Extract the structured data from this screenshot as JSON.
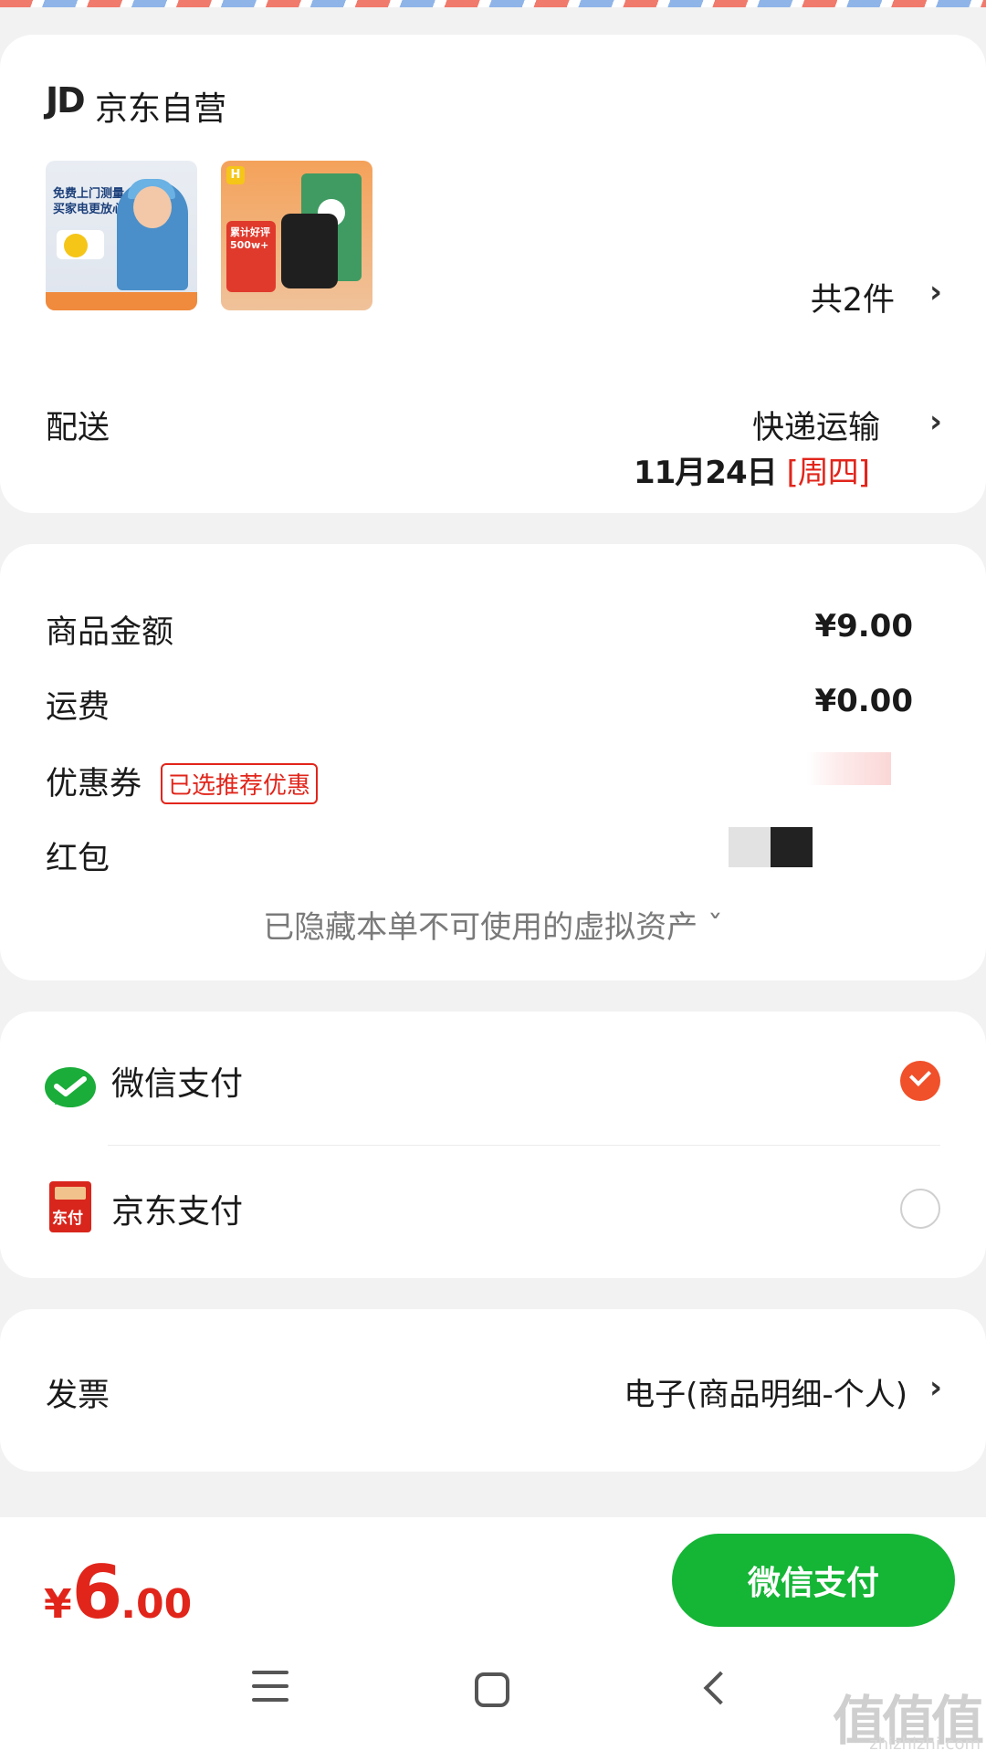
{
  "store": {
    "logo": "JD",
    "name": "京东自营"
  },
  "products": {
    "item1_caption_lines": [
      "免费上门测量",
      "买家电更放心"
    ],
    "item2_tag_lines": [
      "累计好评",
      "500w+"
    ],
    "count_text": "共2件"
  },
  "shipping": {
    "label": "配送",
    "method": "快递运输",
    "date": "11月24日",
    "weekday": "[周四]"
  },
  "amounts": {
    "goods_label": "商品金额",
    "goods_value": "¥9.00",
    "freight_label": "运费",
    "freight_value": "¥0.00",
    "coupon_label": "优惠券",
    "coupon_tag": "已选推荐优惠",
    "redpacket_label": "红包",
    "hidden_assets": "已隐藏本单不可使用的虚拟资产 ˇ"
  },
  "payment": {
    "options": [
      {
        "label": "微信支付",
        "selected": true
      },
      {
        "label": "京东支付",
        "selected": false
      }
    ],
    "jd_icon_text": "东付"
  },
  "invoice": {
    "label": "发票",
    "value": "电子(商品明细-个人)"
  },
  "footer": {
    "total_symbol": "¥",
    "total_int": "6",
    "total_dec": ".00",
    "pay_button": "微信支付"
  },
  "watermark": {
    "main": "值值值",
    "sub": "zhizhizhi.com"
  },
  "colors": {
    "accent_red": "#e1251b",
    "wechat_green": "#15b536",
    "radio_selected": "#f0502a"
  }
}
